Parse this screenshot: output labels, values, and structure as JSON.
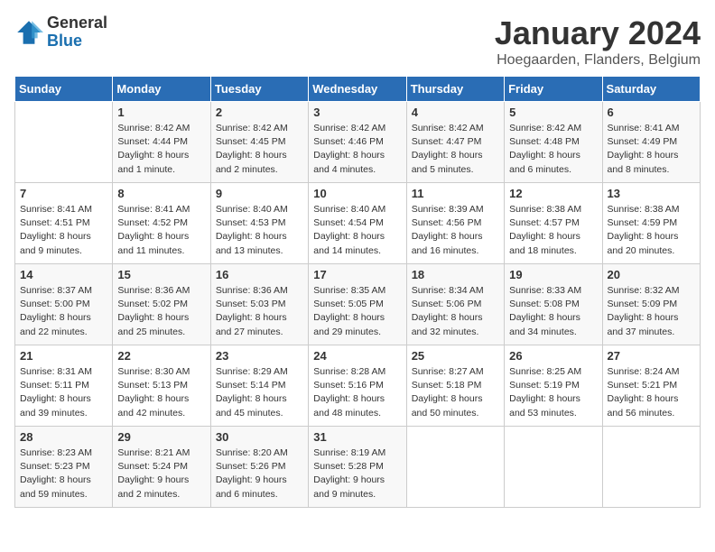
{
  "header": {
    "logo_line1": "General",
    "logo_line2": "Blue",
    "title": "January 2024",
    "subtitle": "Hoegaarden, Flanders, Belgium"
  },
  "days_of_week": [
    "Sunday",
    "Monday",
    "Tuesday",
    "Wednesday",
    "Thursday",
    "Friday",
    "Saturday"
  ],
  "weeks": [
    [
      {
        "day": "",
        "info": ""
      },
      {
        "day": "1",
        "info": "Sunrise: 8:42 AM\nSunset: 4:44 PM\nDaylight: 8 hours\nand 1 minute."
      },
      {
        "day": "2",
        "info": "Sunrise: 8:42 AM\nSunset: 4:45 PM\nDaylight: 8 hours\nand 2 minutes."
      },
      {
        "day": "3",
        "info": "Sunrise: 8:42 AM\nSunset: 4:46 PM\nDaylight: 8 hours\nand 4 minutes."
      },
      {
        "day": "4",
        "info": "Sunrise: 8:42 AM\nSunset: 4:47 PM\nDaylight: 8 hours\nand 5 minutes."
      },
      {
        "day": "5",
        "info": "Sunrise: 8:42 AM\nSunset: 4:48 PM\nDaylight: 8 hours\nand 6 minutes."
      },
      {
        "day": "6",
        "info": "Sunrise: 8:41 AM\nSunset: 4:49 PM\nDaylight: 8 hours\nand 8 minutes."
      }
    ],
    [
      {
        "day": "7",
        "info": "Sunrise: 8:41 AM\nSunset: 4:51 PM\nDaylight: 8 hours\nand 9 minutes."
      },
      {
        "day": "8",
        "info": "Sunrise: 8:41 AM\nSunset: 4:52 PM\nDaylight: 8 hours\nand 11 minutes."
      },
      {
        "day": "9",
        "info": "Sunrise: 8:40 AM\nSunset: 4:53 PM\nDaylight: 8 hours\nand 13 minutes."
      },
      {
        "day": "10",
        "info": "Sunrise: 8:40 AM\nSunset: 4:54 PM\nDaylight: 8 hours\nand 14 minutes."
      },
      {
        "day": "11",
        "info": "Sunrise: 8:39 AM\nSunset: 4:56 PM\nDaylight: 8 hours\nand 16 minutes."
      },
      {
        "day": "12",
        "info": "Sunrise: 8:38 AM\nSunset: 4:57 PM\nDaylight: 8 hours\nand 18 minutes."
      },
      {
        "day": "13",
        "info": "Sunrise: 8:38 AM\nSunset: 4:59 PM\nDaylight: 8 hours\nand 20 minutes."
      }
    ],
    [
      {
        "day": "14",
        "info": "Sunrise: 8:37 AM\nSunset: 5:00 PM\nDaylight: 8 hours\nand 22 minutes."
      },
      {
        "day": "15",
        "info": "Sunrise: 8:36 AM\nSunset: 5:02 PM\nDaylight: 8 hours\nand 25 minutes."
      },
      {
        "day": "16",
        "info": "Sunrise: 8:36 AM\nSunset: 5:03 PM\nDaylight: 8 hours\nand 27 minutes."
      },
      {
        "day": "17",
        "info": "Sunrise: 8:35 AM\nSunset: 5:05 PM\nDaylight: 8 hours\nand 29 minutes."
      },
      {
        "day": "18",
        "info": "Sunrise: 8:34 AM\nSunset: 5:06 PM\nDaylight: 8 hours\nand 32 minutes."
      },
      {
        "day": "19",
        "info": "Sunrise: 8:33 AM\nSunset: 5:08 PM\nDaylight: 8 hours\nand 34 minutes."
      },
      {
        "day": "20",
        "info": "Sunrise: 8:32 AM\nSunset: 5:09 PM\nDaylight: 8 hours\nand 37 minutes."
      }
    ],
    [
      {
        "day": "21",
        "info": "Sunrise: 8:31 AM\nSunset: 5:11 PM\nDaylight: 8 hours\nand 39 minutes."
      },
      {
        "day": "22",
        "info": "Sunrise: 8:30 AM\nSunset: 5:13 PM\nDaylight: 8 hours\nand 42 minutes."
      },
      {
        "day": "23",
        "info": "Sunrise: 8:29 AM\nSunset: 5:14 PM\nDaylight: 8 hours\nand 45 minutes."
      },
      {
        "day": "24",
        "info": "Sunrise: 8:28 AM\nSunset: 5:16 PM\nDaylight: 8 hours\nand 48 minutes."
      },
      {
        "day": "25",
        "info": "Sunrise: 8:27 AM\nSunset: 5:18 PM\nDaylight: 8 hours\nand 50 minutes."
      },
      {
        "day": "26",
        "info": "Sunrise: 8:25 AM\nSunset: 5:19 PM\nDaylight: 8 hours\nand 53 minutes."
      },
      {
        "day": "27",
        "info": "Sunrise: 8:24 AM\nSunset: 5:21 PM\nDaylight: 8 hours\nand 56 minutes."
      }
    ],
    [
      {
        "day": "28",
        "info": "Sunrise: 8:23 AM\nSunset: 5:23 PM\nDaylight: 8 hours\nand 59 minutes."
      },
      {
        "day": "29",
        "info": "Sunrise: 8:21 AM\nSunset: 5:24 PM\nDaylight: 9 hours\nand 2 minutes."
      },
      {
        "day": "30",
        "info": "Sunrise: 8:20 AM\nSunset: 5:26 PM\nDaylight: 9 hours\nand 6 minutes."
      },
      {
        "day": "31",
        "info": "Sunrise: 8:19 AM\nSunset: 5:28 PM\nDaylight: 9 hours\nand 9 minutes."
      },
      {
        "day": "",
        "info": ""
      },
      {
        "day": "",
        "info": ""
      },
      {
        "day": "",
        "info": ""
      }
    ]
  ]
}
